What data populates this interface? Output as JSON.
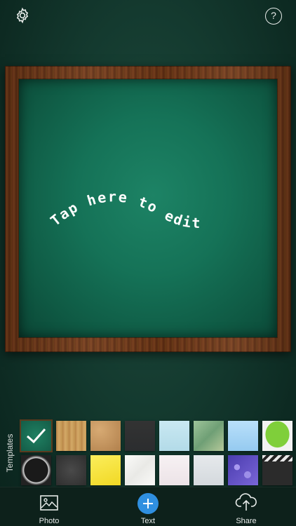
{
  "topbar": {
    "help_label": "?"
  },
  "board": {
    "prompt_text": "Tap here to edit"
  },
  "templates": {
    "label": "Templates",
    "selected_index": 0,
    "row1": [
      {
        "name": "green-chalkboard",
        "bg": "#1d6e55"
      },
      {
        "name": "wood-plank",
        "bg": "#c79a5a"
      },
      {
        "name": "cork-board",
        "bg": "#c0915f"
      },
      {
        "name": "black-chalkboard-wood-frame",
        "bg": "#2d2f31"
      },
      {
        "name": "light-blue-paper",
        "bg": "#bfe2ee"
      },
      {
        "name": "map-paper",
        "bg": "#8fb58e"
      },
      {
        "name": "blue-sticky-note",
        "bg": "#a8d6f5"
      },
      {
        "name": "green-speech-bubble",
        "bg": "#f0f0f0"
      }
    ],
    "row2": [
      {
        "name": "black-grunge-frame",
        "bg": "#222"
      },
      {
        "name": "dark-chalkboard",
        "bg": "#3a3a3a"
      },
      {
        "name": "yellow-sticky-note",
        "bg": "#f6e43f"
      },
      {
        "name": "white-crumpled-paper",
        "bg": "#f4f4f2"
      },
      {
        "name": "pink-notepad",
        "bg": "#f4eef0"
      },
      {
        "name": "gray-paper",
        "bg": "#dfe3e6"
      },
      {
        "name": "purple-bokeh",
        "bg": "#6b57c7"
      },
      {
        "name": "clapperboard",
        "bg": "#2a2a2a"
      }
    ]
  },
  "toolbar": {
    "photo_label": "Photo",
    "text_label": "Text",
    "share_label": "Share"
  },
  "colors": {
    "accent_blue": "#2f8fe0",
    "background_green": "#143a2f",
    "chalkboard_green": "#157257"
  }
}
